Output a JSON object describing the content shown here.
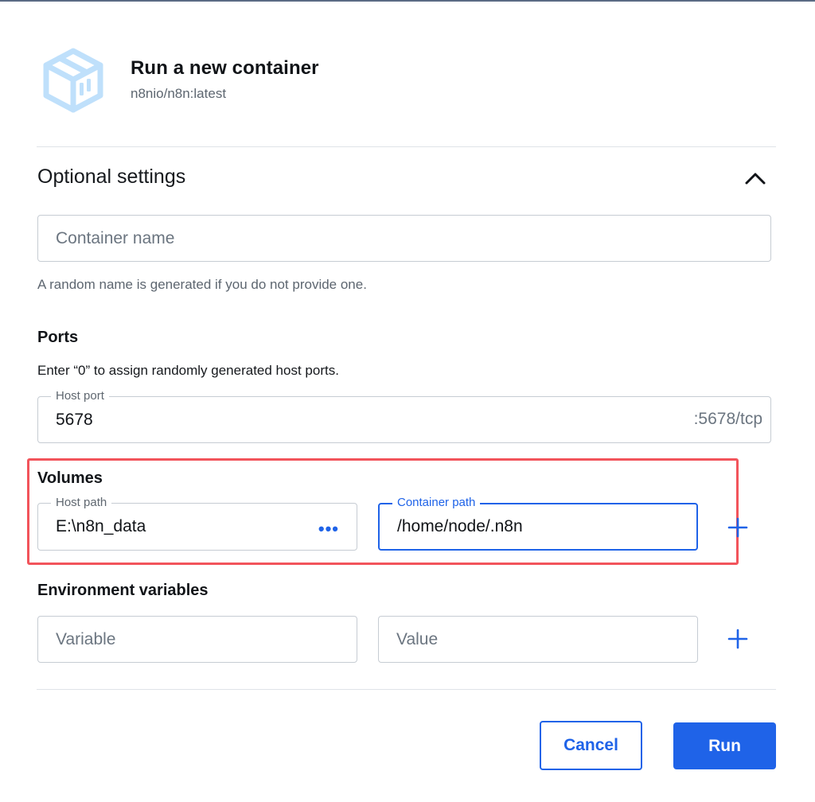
{
  "header": {
    "title": "Run a new container",
    "image": "n8nio/n8n:latest",
    "icon": "container-cube-icon"
  },
  "optional_settings": {
    "title": "Optional settings",
    "expanded": true
  },
  "container_name": {
    "placeholder": "Container name",
    "helper": "A random name is generated if you do not provide one."
  },
  "ports": {
    "title": "Ports",
    "note": "Enter “0” to assign randomly generated host ports.",
    "host_port_label": "Host port",
    "host_port_value": "5678",
    "container_port": ":5678/tcp"
  },
  "volumes": {
    "title": "Volumes",
    "host_path_label": "Host path",
    "host_path_value": "E:\\n8n_data",
    "browse_icon": "more-dots-icon",
    "container_path_label": "Container path",
    "container_path_value": "/home/node/.n8n"
  },
  "env": {
    "title": "Environment variables",
    "variable_placeholder": "Variable",
    "value_placeholder": "Value"
  },
  "actions": {
    "cancel": "Cancel",
    "run": "Run"
  },
  "colors": {
    "accent": "#1f63e8",
    "highlight": "#f2545b",
    "logo": "#bfe0fb"
  }
}
